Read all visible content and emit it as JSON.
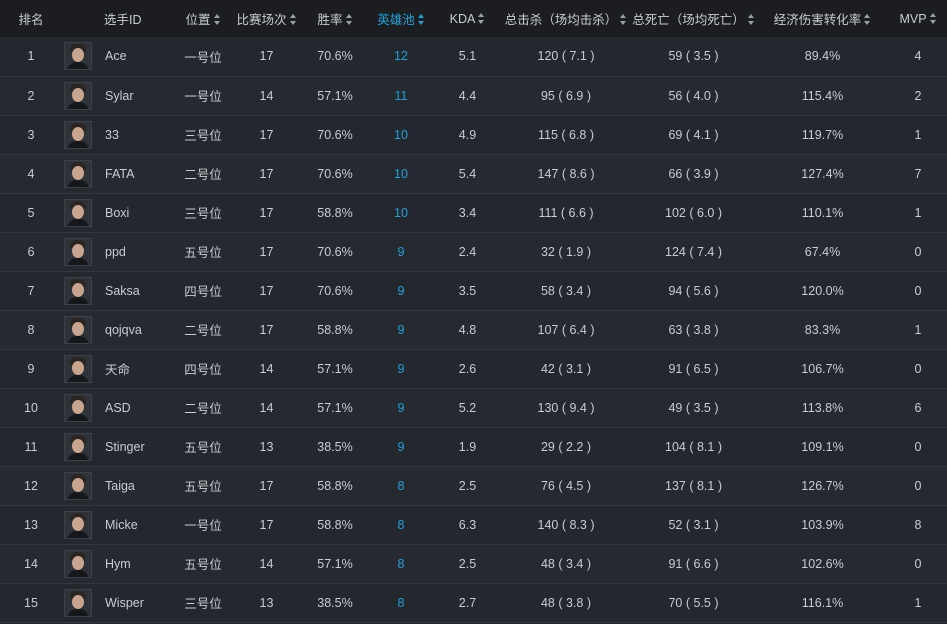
{
  "headers": {
    "rank": "排名",
    "player_id": "选手ID",
    "position": "位置",
    "matches": "比赛场次",
    "win_rate": "胜率",
    "hero_pool": "英雄池",
    "kda": "KDA",
    "kills": "总击杀（场均击杀）",
    "deaths": "总死亡（场均死亡）",
    "dmg_conversion": "经济伤害转化率",
    "mvp": "MVP"
  },
  "accent_color": "#1fa3d9",
  "rows": [
    {
      "rank": "1",
      "name": "Ace",
      "position": "一号位",
      "matches": "17",
      "win_rate": "70.6%",
      "hero_pool": "12",
      "kda": "5.1",
      "kills": "120 ( 7.1 )",
      "deaths": "59 ( 3.5 )",
      "dmg": "89.4%",
      "mvp": "4"
    },
    {
      "rank": "2",
      "name": "Sylar",
      "position": "一号位",
      "matches": "14",
      "win_rate": "57.1%",
      "hero_pool": "11",
      "kda": "4.4",
      "kills": "95 ( 6.9 )",
      "deaths": "56 ( 4.0 )",
      "dmg": "115.4%",
      "mvp": "2"
    },
    {
      "rank": "3",
      "name": "33",
      "position": "三号位",
      "matches": "17",
      "win_rate": "70.6%",
      "hero_pool": "10",
      "kda": "4.9",
      "kills": "115 ( 6.8 )",
      "deaths": "69 ( 4.1 )",
      "dmg": "119.7%",
      "mvp": "1"
    },
    {
      "rank": "4",
      "name": "FATA",
      "position": "二号位",
      "matches": "17",
      "win_rate": "70.6%",
      "hero_pool": "10",
      "kda": "5.4",
      "kills": "147 ( 8.6 )",
      "deaths": "66 ( 3.9 )",
      "dmg": "127.4%",
      "mvp": "7"
    },
    {
      "rank": "5",
      "name": "Boxi",
      "position": "三号位",
      "matches": "17",
      "win_rate": "58.8%",
      "hero_pool": "10",
      "kda": "3.4",
      "kills": "111 ( 6.6 )",
      "deaths": "102 ( 6.0 )",
      "dmg": "110.1%",
      "mvp": "1"
    },
    {
      "rank": "6",
      "name": "ppd",
      "position": "五号位",
      "matches": "17",
      "win_rate": "70.6%",
      "hero_pool": "9",
      "kda": "2.4",
      "kills": "32 ( 1.9 )",
      "deaths": "124 ( 7.4 )",
      "dmg": "67.4%",
      "mvp": "0"
    },
    {
      "rank": "7",
      "name": "Saksa",
      "position": "四号位",
      "matches": "17",
      "win_rate": "70.6%",
      "hero_pool": "9",
      "kda": "3.5",
      "kills": "58 ( 3.4 )",
      "deaths": "94 ( 5.6 )",
      "dmg": "120.0%",
      "mvp": "0"
    },
    {
      "rank": "8",
      "name": "qojqva",
      "position": "二号位",
      "matches": "17",
      "win_rate": "58.8%",
      "hero_pool": "9",
      "kda": "4.8",
      "kills": "107 ( 6.4 )",
      "deaths": "63 ( 3.8 )",
      "dmg": "83.3%",
      "mvp": "1"
    },
    {
      "rank": "9",
      "name": "天命",
      "position": "四号位",
      "matches": "14",
      "win_rate": "57.1%",
      "hero_pool": "9",
      "kda": "2.6",
      "kills": "42 ( 3.1 )",
      "deaths": "91 ( 6.5 )",
      "dmg": "106.7%",
      "mvp": "0"
    },
    {
      "rank": "10",
      "name": "ASD",
      "position": "二号位",
      "matches": "14",
      "win_rate": "57.1%",
      "hero_pool": "9",
      "kda": "5.2",
      "kills": "130 ( 9.4 )",
      "deaths": "49 ( 3.5 )",
      "dmg": "113.8%",
      "mvp": "6"
    },
    {
      "rank": "11",
      "name": "Stinger",
      "position": "五号位",
      "matches": "13",
      "win_rate": "38.5%",
      "hero_pool": "9",
      "kda": "1.9",
      "kills": "29 ( 2.2 )",
      "deaths": "104 ( 8.1 )",
      "dmg": "109.1%",
      "mvp": "0"
    },
    {
      "rank": "12",
      "name": "Taiga",
      "position": "五号位",
      "matches": "17",
      "win_rate": "58.8%",
      "hero_pool": "8",
      "kda": "2.5",
      "kills": "76 ( 4.5 )",
      "deaths": "137 ( 8.1 )",
      "dmg": "126.7%",
      "mvp": "0"
    },
    {
      "rank": "13",
      "name": "Micke",
      "position": "一号位",
      "matches": "17",
      "win_rate": "58.8%",
      "hero_pool": "8",
      "kda": "6.3",
      "kills": "140 ( 8.3 )",
      "deaths": "52 ( 3.1 )",
      "dmg": "103.9%",
      "mvp": "8"
    },
    {
      "rank": "14",
      "name": "Hym",
      "position": "五号位",
      "matches": "14",
      "win_rate": "57.1%",
      "hero_pool": "8",
      "kda": "2.5",
      "kills": "48 ( 3.4 )",
      "deaths": "91 ( 6.6 )",
      "dmg": "102.6%",
      "mvp": "0"
    },
    {
      "rank": "15",
      "name": "Wisper",
      "position": "三号位",
      "matches": "13",
      "win_rate": "38.5%",
      "hero_pool": "8",
      "kda": "2.7",
      "kills": "48 ( 3.8 )",
      "deaths": "70 ( 5.5 )",
      "dmg": "116.1%",
      "mvp": "1"
    }
  ]
}
